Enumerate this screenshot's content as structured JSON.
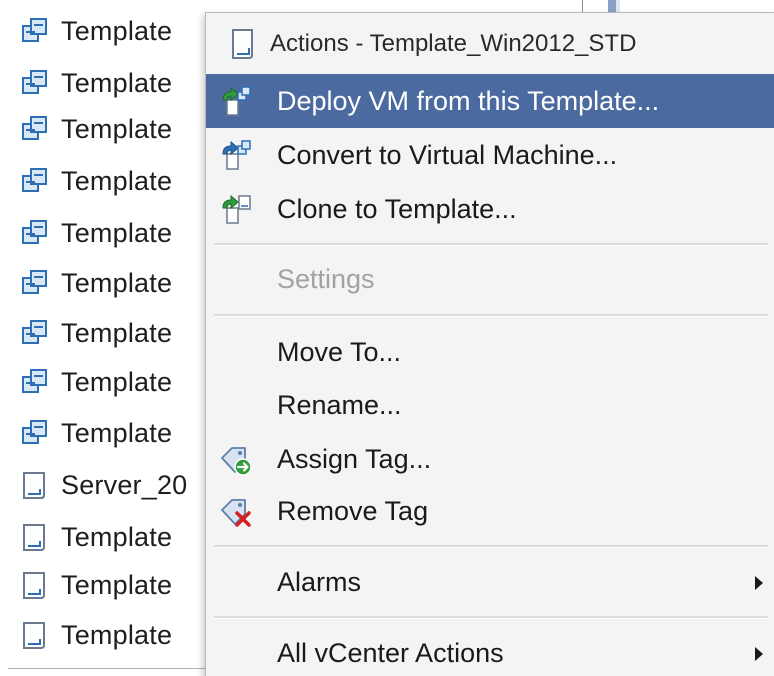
{
  "tree": {
    "items": [
      {
        "label": "Template",
        "icon": "template-folder-icon"
      },
      {
        "label": "Template",
        "icon": "template-folder-icon"
      },
      {
        "label": "Template",
        "icon": "template-folder-icon"
      },
      {
        "label": "Template",
        "icon": "template-folder-icon"
      },
      {
        "label": "Template",
        "icon": "template-folder-icon"
      },
      {
        "label": "Template",
        "icon": "template-folder-icon"
      },
      {
        "label": "Template",
        "icon": "template-folder-icon"
      },
      {
        "label": "Template",
        "icon": "template-folder-icon"
      },
      {
        "label": "Template",
        "icon": "template-folder-icon"
      },
      {
        "label": "Server_20",
        "icon": "vm-template-icon"
      },
      {
        "label": "Template",
        "icon": "vm-template-icon"
      },
      {
        "label": "Template",
        "icon": "vm-template-icon"
      },
      {
        "label": "Template",
        "icon": "vm-template-icon"
      }
    ]
  },
  "menu": {
    "header": {
      "title": "Actions - Template_Win2012_STD",
      "icon": "vm-template-icon"
    },
    "items": [
      {
        "label": "Deploy VM from this Template...",
        "icon": "deploy-vm-icon",
        "state": "selected"
      },
      {
        "label": "Convert to Virtual Machine...",
        "icon": "convert-vm-icon",
        "state": "normal"
      },
      {
        "label": "Clone to Template...",
        "icon": "clone-template-icon",
        "state": "normal"
      },
      {
        "label": "Settings",
        "icon": "",
        "state": "disabled"
      },
      {
        "label": "Move To...",
        "icon": "",
        "state": "normal"
      },
      {
        "label": "Rename...",
        "icon": "",
        "state": "normal"
      },
      {
        "label": "Assign Tag...",
        "icon": "assign-tag-icon",
        "state": "normal"
      },
      {
        "label": "Remove Tag",
        "icon": "remove-tag-icon",
        "state": "normal"
      },
      {
        "label": "Alarms",
        "icon": "",
        "state": "normal",
        "submenu": true
      },
      {
        "label": "All vCenter Actions",
        "icon": "",
        "state": "normal",
        "submenu": true
      }
    ]
  },
  "colors": {
    "selection": "#4a6aa0",
    "menu_background": "#f4f4f4",
    "disabled_text": "#a2a2a2"
  }
}
